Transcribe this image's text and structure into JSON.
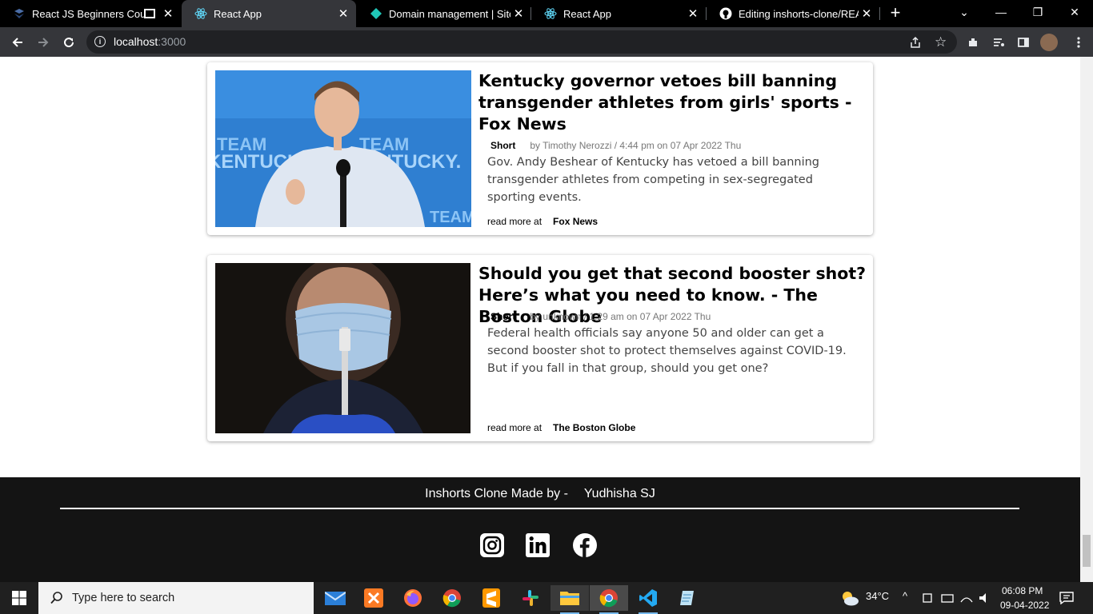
{
  "browser": {
    "tabs": [
      {
        "label": "React JS Beginners Cours",
        "icon": "site-icon",
        "close": "✕"
      },
      {
        "label": "React App",
        "icon": "react-icon",
        "close": "✕"
      },
      {
        "label": "Domain management | Site s",
        "icon": "netlify-icon",
        "close": "✕"
      },
      {
        "label": "React App",
        "icon": "react-icon",
        "close": "✕"
      },
      {
        "label": "Editing inshorts-clone/READI",
        "icon": "github-icon",
        "close": "✕"
      }
    ],
    "new_tab": "+",
    "url_host": "localhost",
    "url_port": ":3000",
    "window_buttons": [
      "⌄",
      "—",
      "❐",
      "✕"
    ]
  },
  "articles": [
    {
      "title": "Kentucky governor vetoes bill banning transgender athletes from girls' sports - Fox News",
      "tag": "Short",
      "byline": "by Timothy Nerozzi / 4:44 pm on 07 Apr 2022 Thu",
      "description": "Gov. Andy Beshear of Kentucky has vetoed a bill banning transgender athletes from competing in sex-segregated sporting events.",
      "read_more": "read more at",
      "source": "Fox News"
    },
    {
      "title": "Should you get that second booster shot? Here’s what you need to know. - The Boston Globe",
      "tag": "Short",
      "byline": "by unknown / 1:29 am on 07 Apr 2022 Thu",
      "description": "Federal health officials say anyone 50 and older can get a second booster shot to protect themselves against COVID-19. But if you fall in that group, should you get one?",
      "read_more": "read more at",
      "source": "The Boston Globe"
    }
  ],
  "footer": {
    "credit_prefix": "Inshorts Clone Made by -",
    "credit_name": "Yudhisha SJ",
    "social": [
      "instagram-icon",
      "linkedin-icon",
      "facebook-icon"
    ]
  },
  "taskbar": {
    "search_placeholder": "Type here to search",
    "weather": "34°C",
    "time": "06:08 PM",
    "date": "09-04-2022"
  }
}
